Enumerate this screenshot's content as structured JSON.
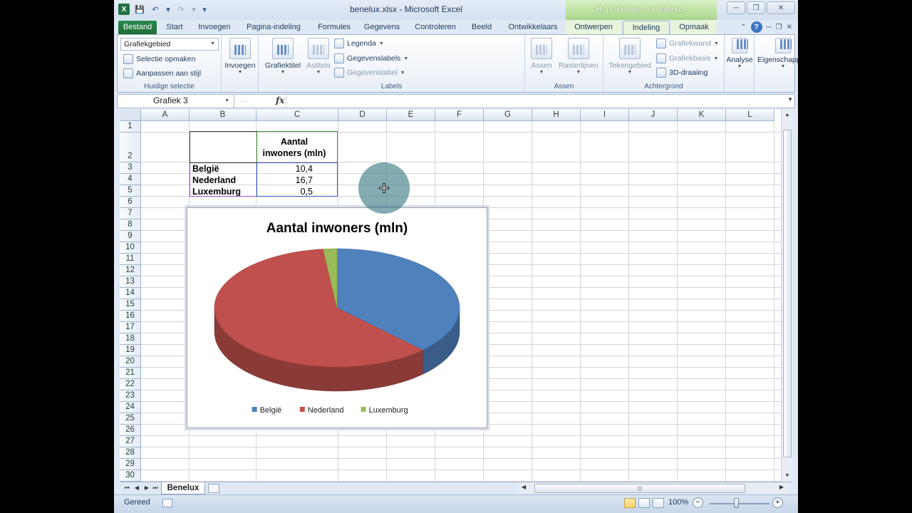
{
  "window": {
    "title": "benelux.xlsx  -  Microsoft Excel",
    "context_title": "Hulpmiddelen voor grafieken"
  },
  "tabs": [
    {
      "label": "Bestand"
    },
    {
      "label": "Start"
    },
    {
      "label": "Invoegen"
    },
    {
      "label": "Pagina-indeling"
    },
    {
      "label": "Formules"
    },
    {
      "label": "Gegevens"
    },
    {
      "label": "Controleren"
    },
    {
      "label": "Beeld"
    },
    {
      "label": "Ontwikkelaars"
    },
    {
      "label": "Ontwerpen"
    },
    {
      "label": "Indeling"
    },
    {
      "label": "Opmaak"
    }
  ],
  "ribbon": {
    "current_selection": {
      "dropdown_value": "Grafiekgebied",
      "format_selection": "Selectie opmaken",
      "reset_style": "Aanpassen aan stijl",
      "group_label": "Huidige selectie"
    },
    "insert": {
      "label": "Invoegen"
    },
    "labels": {
      "chart_title": "Grafiektitel",
      "axis_titles": "Astitels",
      "legend": "Legenda",
      "data_labels": "Gegevenslabels",
      "data_table": "Gegevenstabel",
      "group_label": "Labels"
    },
    "axes": {
      "axes": "Assen",
      "gridlines": "Rasterlijnen",
      "group_label": "Assen"
    },
    "background": {
      "plot_area": "Tekengebied",
      "chart_wall": "Grafiekwand",
      "chart_floor": "Grafiekbasis",
      "rotation": "3D-draaiing",
      "group_label": "Achtergrond"
    },
    "analysis": {
      "label": "Analyse"
    },
    "properties": {
      "label": "Eigenschappen"
    }
  },
  "formula_bar": {
    "name_box": "Grafiek 3",
    "fx": "fx",
    "value": ""
  },
  "sheet": {
    "columns": [
      "A",
      "B",
      "C",
      "D",
      "E",
      "F",
      "G",
      "H",
      "I",
      "J",
      "K",
      "L"
    ],
    "rows": [
      "1",
      "2",
      "3",
      "4",
      "5",
      "6",
      "7",
      "8",
      "9",
      "10",
      "11",
      "12",
      "13",
      "14",
      "15",
      "16",
      "17",
      "18",
      "19",
      "20",
      "21",
      "22",
      "23",
      "24",
      "25",
      "26",
      "27",
      "28",
      "29",
      "30"
    ],
    "header_line1": "Aantal",
    "header_line2": "inwoners (mln)",
    "data": [
      {
        "country": "België",
        "value": "10,4"
      },
      {
        "country": "Nederland",
        "value": "16,7"
      },
      {
        "country": "Luxemburg",
        "value": "0,5"
      }
    ],
    "tab_name": "Benelux"
  },
  "status": {
    "ready": "Gereed",
    "zoom": "100%"
  },
  "chart_data": {
    "type": "pie",
    "title": "Aantal inwoners (mln)",
    "categories": [
      "België",
      "Nederland",
      "Luxemburg"
    ],
    "values": [
      10.4,
      16.7,
      0.5
    ],
    "colors": [
      "#4f81bd",
      "#c0504d",
      "#9bbb59"
    ],
    "legend": "bottom",
    "style": "3d"
  }
}
